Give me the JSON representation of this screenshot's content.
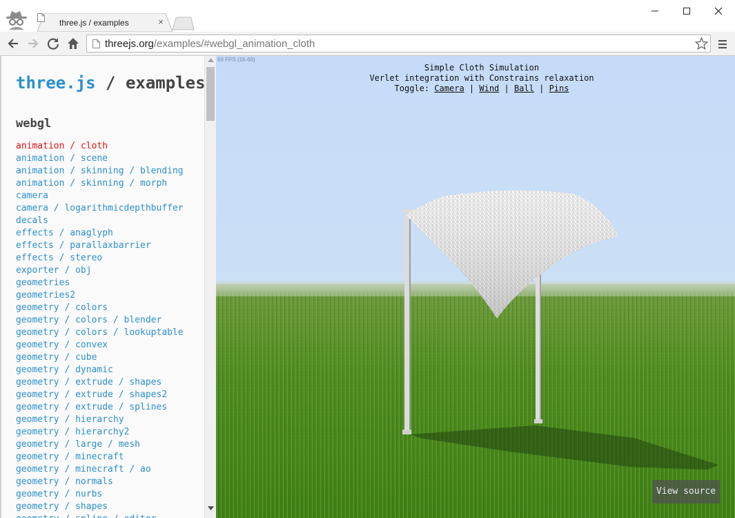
{
  "browser": {
    "tab_title": "three.js / examples",
    "tab_close": "×",
    "url_host": "threejs.org",
    "url_path": "/examples/#webgl_animation_cloth"
  },
  "sidebar": {
    "title_brand": "three.js",
    "title_rest": " / examples",
    "section": "webgl",
    "selected_index": 0,
    "items": [
      "animation / cloth",
      "animation / scene",
      "animation / skinning / blending",
      "animation / skinning / morph",
      "camera",
      "camera / logarithmicdepthbuffer",
      "decals",
      "effects / anaglyph",
      "effects / parallaxbarrier",
      "effects / stereo",
      "exporter / obj",
      "geometries",
      "geometries2",
      "geometry / colors",
      "geometry / colors / blender",
      "geometry / colors / lookuptable",
      "geometry / convex",
      "geometry / cube",
      "geometry / dynamic",
      "geometry / extrude / shapes",
      "geometry / extrude / shapes2",
      "geometry / extrude / splines",
      "geometry / hierarchy",
      "geometry / hierarchy2",
      "geometry / large / mesh",
      "geometry / minecraft",
      "geometry / minecraft / ao",
      "geometry / normals",
      "geometry / nurbs",
      "geometry / shapes",
      "geometry / spline / editor"
    ]
  },
  "viewer": {
    "fps": "60 FPS (16-60)",
    "line1": "Simple Cloth Simulation",
    "line2": "Verlet integration with Constrains relaxation",
    "toggle_label": "Toggle:",
    "sep": " | ",
    "toggles": [
      "Camera",
      "Wind",
      "Ball",
      "Pins"
    ],
    "view_source": "View source"
  },
  "colors": {
    "link": "#2c8fce",
    "selected": "#e0120f",
    "sky": "#c7dcf7",
    "grass": "#4f8a1c"
  }
}
